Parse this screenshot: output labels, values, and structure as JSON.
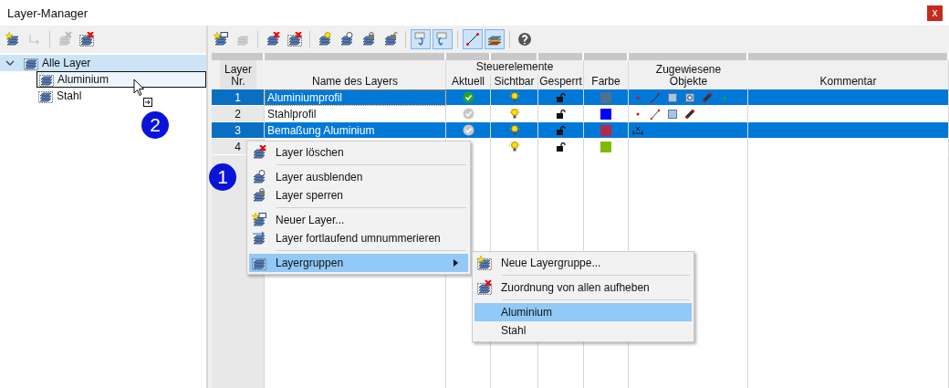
{
  "window": {
    "title": "Layer-Manager",
    "close": "x"
  },
  "left_toolbar": [
    {
      "kind": "stack-star",
      "disabled": false,
      "pressed": false
    },
    {
      "kind": "ab",
      "disabled": true,
      "pressed": false
    },
    {
      "kind": "separator"
    },
    {
      "kind": "stack-cross",
      "disabled": true,
      "pressed": false
    },
    {
      "kind": "dashed-cross",
      "disabled": false,
      "pressed": false
    }
  ],
  "tree": [
    {
      "label": "Alle Layer",
      "selected": true,
      "expanded": true,
      "children": [
        {
          "label": "Aluminium",
          "selected": false,
          "drop_target": true
        },
        {
          "label": "Stahl",
          "selected": false,
          "drop_target": false
        }
      ]
    }
  ],
  "toolbar": [
    {
      "kind": "stack-window",
      "disabled": false,
      "pressed": false
    },
    {
      "kind": "stack",
      "disabled": true,
      "pressed": false
    },
    {
      "kind": "separator"
    },
    {
      "kind": "stack-cross",
      "disabled": false,
      "pressed": false
    },
    {
      "kind": "dashed-cross",
      "disabled": false,
      "pressed": false
    },
    {
      "kind": "separator"
    },
    {
      "kind": "stack-bulb",
      "disabled": false,
      "pressed": false
    },
    {
      "kind": "stack-bulb-off",
      "disabled": false,
      "pressed": false
    },
    {
      "kind": "stack-lock",
      "disabled": false,
      "pressed": false
    },
    {
      "kind": "stack-unlock",
      "disabled": false,
      "pressed": false
    },
    {
      "kind": "separator"
    },
    {
      "kind": "undo",
      "disabled": false,
      "pressed": true
    },
    {
      "kind": "redo",
      "disabled": false,
      "pressed": true
    },
    {
      "kind": "separator"
    },
    {
      "kind": "line",
      "disabled": false,
      "pressed": true
    },
    {
      "kind": "color-layers",
      "disabled": false,
      "pressed": true
    },
    {
      "kind": "separator"
    },
    {
      "kind": "help",
      "disabled": false,
      "pressed": false
    }
  ],
  "table": {
    "columns": {
      "nr": "Layer Nr.",
      "name": "Name des Layers",
      "group": "Steuerelemente",
      "current": "Aktuell",
      "visible": "Sichtbar",
      "locked": "Gesperrt",
      "colour_header": "Farbe",
      "objects": "Zugewiesene Objekte",
      "comment": "Kommentar"
    },
    "rows": [
      {
        "nr": "1",
        "name": "Aluminiumprofil",
        "selected": true,
        "focused": true,
        "current": true,
        "visible": true,
        "locked": false,
        "color": "#50708f",
        "objects": [
          {
            "kind": "node"
          },
          {
            "kind": "line"
          },
          {
            "kind": "surface"
          },
          {
            "kind": "opening"
          },
          {
            "kind": "member"
          },
          {
            "kind": "dot"
          }
        ]
      },
      {
        "nr": "2",
        "name": "Stahlprofil",
        "selected": false,
        "focused": false,
        "current": false,
        "visible": true,
        "locked": false,
        "color": "#0000ff",
        "objects": [
          {
            "kind": "node"
          },
          {
            "kind": "line"
          },
          {
            "kind": "surface"
          },
          {
            "kind": "member"
          }
        ]
      },
      {
        "nr": "3",
        "name": "Bemaßung Aluminium",
        "selected": true,
        "focused": false,
        "current": false,
        "visible": true,
        "locked": false,
        "color": "#b3294a",
        "objects": [
          {
            "kind": "dimension"
          }
        ]
      },
      {
        "nr": "4",
        "selected": false,
        "focused": false,
        "visible": true,
        "locked": false,
        "color": "#7fba00",
        "objects": []
      }
    ]
  },
  "context_menu": [
    {
      "label": "Layer löschen",
      "kind": "stack-cross",
      "highlighted": false,
      "submenu": false
    },
    {
      "kind": "separator"
    },
    {
      "label": "Layer ausblenden",
      "kind": "stack-bulb-off",
      "highlighted": false,
      "submenu": false
    },
    {
      "label": "Layer sperren",
      "kind": "stack-lock",
      "highlighted": false,
      "submenu": false
    },
    {
      "kind": "separator"
    },
    {
      "label": "Neuer Layer...",
      "kind": "stack-window",
      "highlighted": false,
      "submenu": false
    },
    {
      "label": "Layer fortlaufend umnummerieren",
      "kind": "stack-renumber",
      "highlighted": false,
      "submenu": false
    },
    {
      "kind": "separator"
    },
    {
      "label": "Layergruppen",
      "kind": "dashed",
      "highlighted": true,
      "submenu": true
    }
  ],
  "submenu": [
    {
      "label": "Neue Layergruppe...",
      "kind": "dashed-star",
      "highlighted": false
    },
    {
      "kind": "separator"
    },
    {
      "label": "Zuordnung von allen aufheben",
      "kind": "dashed-cross",
      "highlighted": false
    },
    {
      "kind": "separator"
    },
    {
      "label": "Aluminium",
      "kind": "none",
      "highlighted": true
    },
    {
      "label": "Stahl",
      "kind": "none",
      "highlighted": false
    }
  ],
  "markers": [
    {
      "label": "2"
    },
    {
      "label": "1"
    }
  ]
}
